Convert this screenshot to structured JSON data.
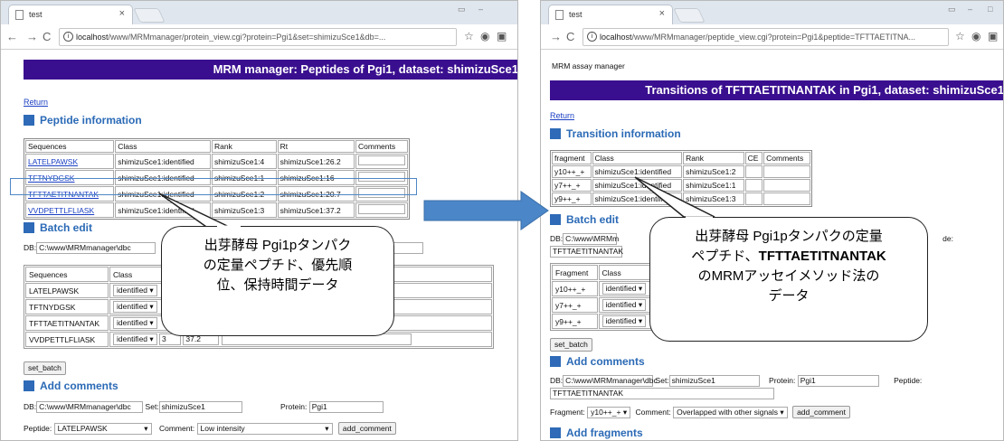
{
  "left": {
    "tab_title": "test",
    "address_host": "localhost",
    "address_path": "/www/MRMmanager/protein_view.cgi?protein=Pgi1&set=shimizuSce1&db=...",
    "header": "MRM manager: Peptides of Pgi1, dataset: shimizuSce1",
    "return_label": "Return",
    "section_peptide": "Peptide information",
    "table_headers": [
      "Sequences",
      "Class",
      "Rank",
      "Rt",
      "Comments"
    ],
    "rows": [
      {
        "seq": "LATELPAWSK",
        "cls": "shimizuSce1:identified",
        "rank": "shimizuSce1:4",
        "rt": "shimizuSce1:26.2"
      },
      {
        "seq": "TFTNYDGSK",
        "cls": "shimizuSce1:identified",
        "rank": "shimizuSce1:1",
        "rt": "shimizuSce1:16"
      },
      {
        "seq": "TFTTAETITNANTAK",
        "cls": "shimizuSce1:identified",
        "rank": "shimizuSce1:2",
        "rt": "shimizuSce1:20.7"
      },
      {
        "seq": "VVDPETTLFLIASK",
        "cls": "shimizuSce1:identified",
        "rank": "shimizuSce1:3",
        "rt": "shimizuSce1:37.2"
      }
    ],
    "section_batch": "Batch edit",
    "db_label": "DB:",
    "db_value": "C:\\www\\MRMmanager\\dbc",
    "batch_headers": [
      "Sequences",
      "Class"
    ],
    "batch_rows": [
      {
        "seq": "LATELPAWSK",
        "cls": "identified"
      },
      {
        "seq": "TFTNYDGSK",
        "cls": "identified"
      },
      {
        "seq": "TFTTAETITNANTAK",
        "cls": "identified"
      },
      {
        "seq": "VVDPETTLFLIASK",
        "cls": "identified",
        "rank": "3",
        "rt": "37.2"
      }
    ],
    "set_batch": "set_batch",
    "section_comments": "Add comments",
    "set_label": "Set:",
    "set_value": "shimizuSce1",
    "protein_label": "Protein:",
    "protein_value": "Pgi1",
    "peptide_label": "Peptide:",
    "peptide_value": "LATELPAWSK",
    "comment_label": "Comment:",
    "comment_value": "Low intensity",
    "add_comment": "add_comment",
    "callout_line1": "出芽酵母 Pgi1pタンパク",
    "callout_line2": "の定量ペプチド、優先順",
    "callout_line3": "位、保持時間データ"
  },
  "right": {
    "tab_title": "test",
    "address_host": "localhost",
    "address_path": "/www/MRMmanager/peptide_view.cgi?protein=Pgi1&peptide=TFTTAETITNA...",
    "app_title": "MRM assay manager",
    "header": "Transitions of TFTTAETITNANTAK in Pgi1, dataset: shimizuSce1",
    "return_label": "Return",
    "section_transition": "Transition information",
    "table_headers": [
      "fragment",
      "Class",
      "Rank",
      "CE",
      "Comments"
    ],
    "rows": [
      {
        "frag": "y10++_+",
        "cls": "shimizuSce1:identified",
        "rank": "shimizuSce1:2"
      },
      {
        "frag": "y7++_+",
        "cls": "shimizuSce1:identified",
        "rank": "shimizuSce1:1"
      },
      {
        "frag": "y9++_+",
        "cls": "shimizuSce1:identified",
        "rank": "shimizuSce1:3"
      }
    ],
    "section_batch": "Batch edit",
    "db_label": "DB:",
    "db_value": "C:\\www\\MRMm",
    "peptide_value_short": "TFTTAETITNANTAK",
    "peptide_label_cut": "de:",
    "batch_headers": [
      "Fragment",
      "Class"
    ],
    "batch_rows": [
      {
        "frag": "y10++_+",
        "cls": "identified"
      },
      {
        "frag": "y7++_+",
        "cls": "identified"
      },
      {
        "frag": "y9++_+",
        "cls": "identified"
      }
    ],
    "set_batch": "set_batch",
    "section_comments": "Add comments",
    "db_value_full": "C:\\www\\MRMmanager\\dbc",
    "set_label": "Set:",
    "set_value": "shimizuSce1",
    "protein_label": "Protein:",
    "protein_value": "Pgi1",
    "peptide_label": "Peptide:",
    "peptide_value": "TFTTAETITNANTAK",
    "fragment_label": "Fragment:",
    "fragment_value": "y10++_+",
    "comment_label": "Comment:",
    "comment_value": "Overlapped with other signals",
    "add_comment": "add_comment",
    "section_fragments": "Add fragments",
    "callout_line1": "出芽酵母 Pgi1pタンパクの定量",
    "callout_line2a": "ペプチド、",
    "callout_line2b": "TFTTAETITNANTAK",
    "callout_line3": "のMRMアッセイメソッド法の",
    "callout_line4": "データ"
  },
  "colors": {
    "header_bg": "#3a0f8f",
    "section": "#2b6ab6",
    "arrow": "#4a86c8"
  }
}
